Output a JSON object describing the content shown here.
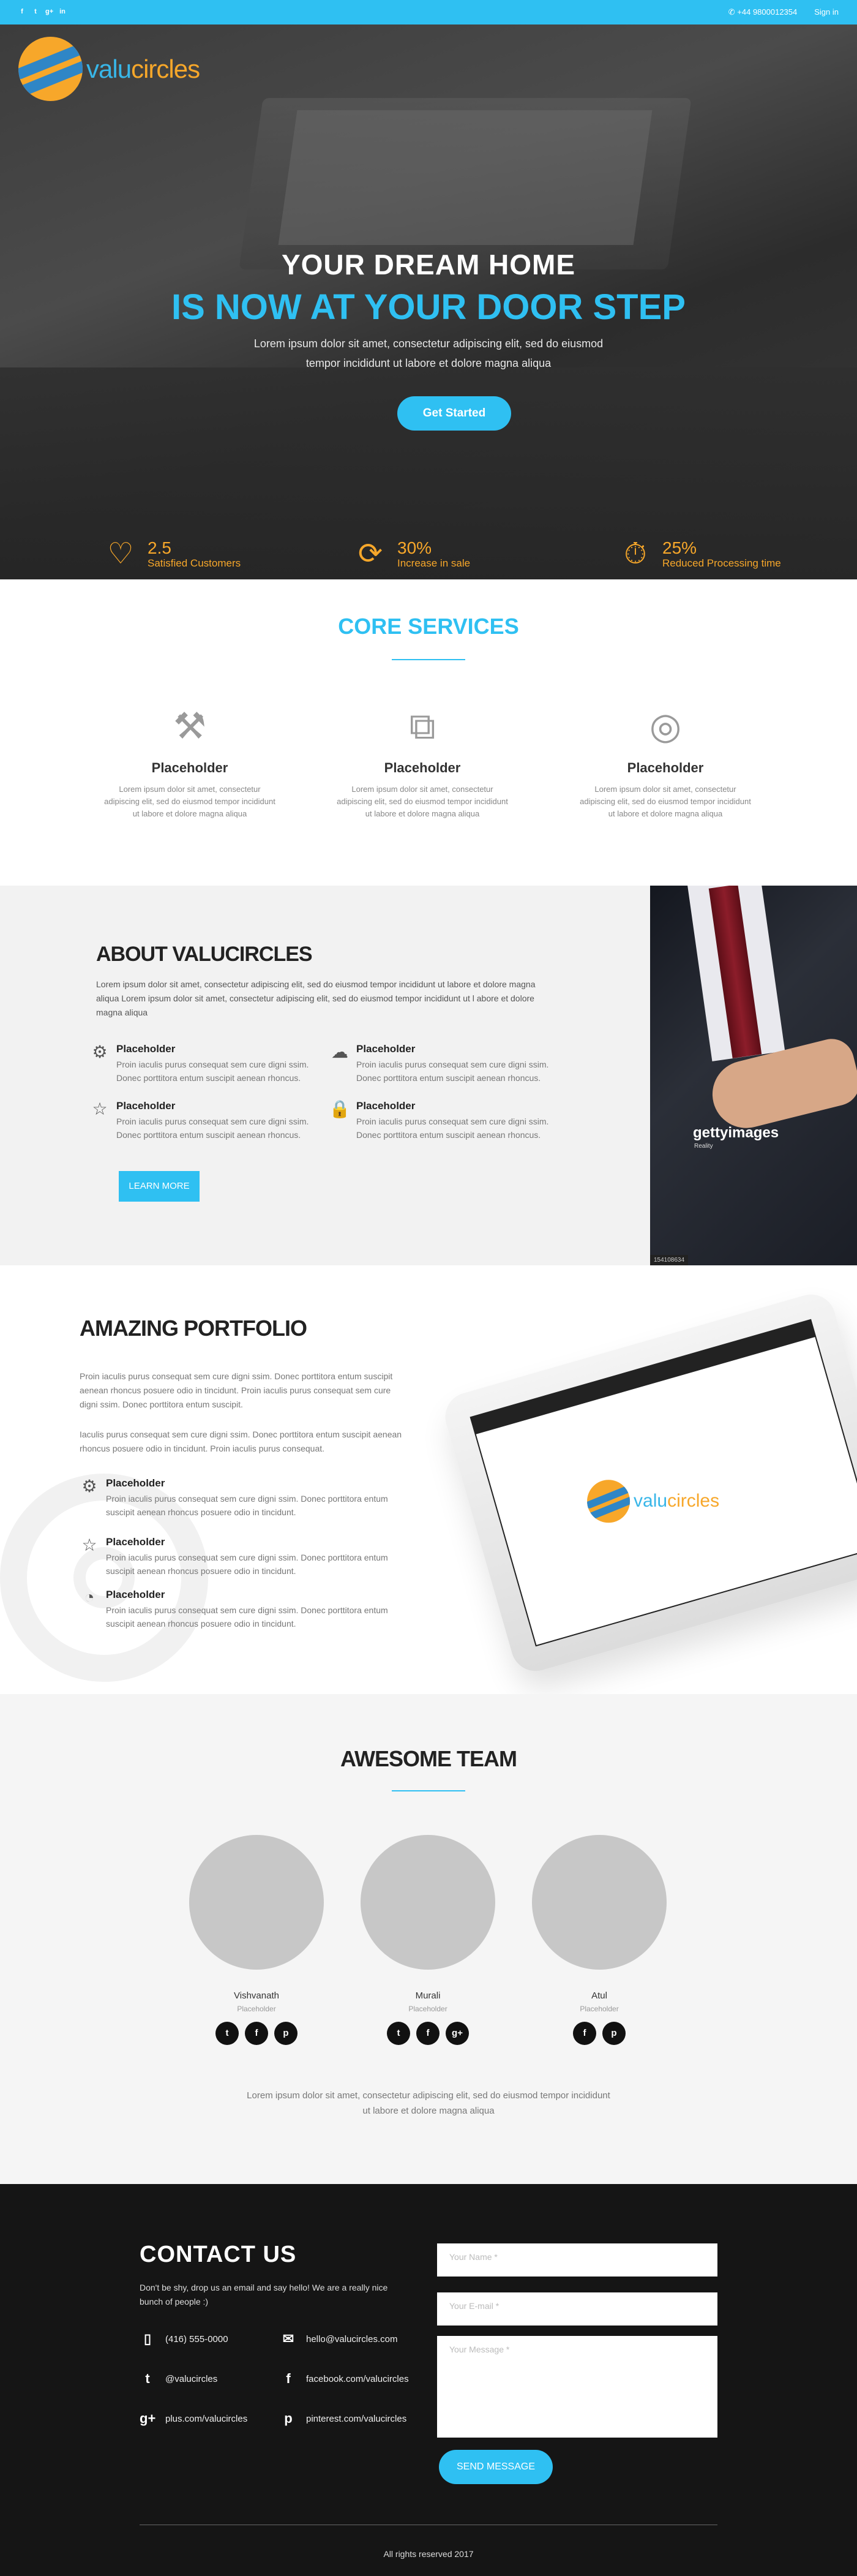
{
  "topbar": {
    "social_icons": [
      "facebook-icon",
      "twitter-icon",
      "google-plus-icon",
      "linkedin-icon"
    ],
    "social_glyphs": [
      "f",
      "t",
      "g+",
      "in"
    ],
    "phone": "+44 9800012354",
    "signin": "Sign in"
  },
  "logo": {
    "part1": "valu",
    "part2": "circles"
  },
  "hero": {
    "title_line1": "YOUR DREAM HOME",
    "title_line2": "IS NOW AT YOUR DOOR STEP",
    "lead": "Lorem ipsum dolor sit amet, consectetur adipiscing elit, sed do eiusmod tempor incididunt ut labore et dolore magna aliqua",
    "cta": "Get Started",
    "stats": [
      {
        "icon": "heart-icon",
        "value": "2.5",
        "label": "Satisfied Customers"
      },
      {
        "icon": "refresh-icon",
        "value": "30%",
        "label": "Increase in sale"
      },
      {
        "icon": "stopwatch-icon",
        "value": "25%",
        "label": "Reduced Processing time"
      }
    ]
  },
  "services": {
    "title": "CORE SERVICES",
    "items": [
      {
        "icon": "tools-icon",
        "title": "Placeholder",
        "text": "Lorem ipsum dolor sit amet, consectetur adipiscing elit, sed do eiusmod tempor incididunt ut labore et dolore magna aliqua"
      },
      {
        "icon": "hierarchy-icon",
        "title": "Placeholder",
        "text": "Lorem ipsum dolor sit amet, consectetur adipiscing elit, sed do eiusmod tempor incididunt ut labore et dolore magna aliqua"
      },
      {
        "icon": "lifebuoy-icon",
        "title": "Placeholder",
        "text": "Lorem ipsum dolor sit amet, consectetur adipiscing elit, sed do eiusmod tempor incididunt ut labore et dolore magna aliqua"
      }
    ]
  },
  "about": {
    "title": "ABOUT VALUCIRCLES",
    "intro": "Lorem ipsum dolor sit amet, consectetur adipiscing elit, sed do eiusmod tempor incididunt ut labore et dolore magna aliqua Lorem ipsum dolor sit amet, consectetur adipiscing elit, sed do eiusmod tempor incididunt ut l abore et dolore magna aliqua",
    "features": [
      {
        "icon": "gear-icon",
        "title": "Placeholder",
        "text": "Proin iaculis purus consequat sem cure digni ssim. Donec porttitora entum suscipit aenean rhoncus."
      },
      {
        "icon": "cloud-icon",
        "title": "Placeholder",
        "text": "Proin iaculis purus consequat sem cure digni ssim. Donec porttitora entum suscipit aenean rhoncus."
      },
      {
        "icon": "star-icon",
        "title": "Placeholder",
        "text": "Proin iaculis purus consequat sem cure digni ssim. Donec porttitora entum suscipit aenean rhoncus."
      },
      {
        "icon": "lock-icon",
        "title": "Placeholder",
        "text": "Proin iaculis purus consequat sem cure digni ssim. Donec porttitora entum suscipit aenean rhoncus."
      }
    ],
    "button": "LEARN MORE",
    "photo": {
      "brand": "gettyimages",
      "credit": "Reality",
      "code": "154108634"
    }
  },
  "portfolio": {
    "title": "AMAZING PORTFOLIO",
    "para1": "Proin iaculis purus consequat sem cure digni ssim. Donec porttitora entum suscipit aenean rhoncus posuere odio in tincidunt. Proin iaculis purus consequat sem cure digni ssim. Donec porttitora entum suscipit.",
    "para2": "Iaculis purus consequat sem cure digni ssim. Donec porttitora entum suscipit aenean rhoncus posuere odio in tincidunt. Proin iaculis purus consequat.",
    "features": [
      {
        "icon": "gear-icon",
        "title": "Placeholder",
        "text": "Proin iaculis purus consequat sem cure digni ssim. Donec porttitora entum suscipit aenean rhoncus posuere odio in tincidunt."
      },
      {
        "icon": "star-icon",
        "title": "Placeholder",
        "text": "Proin iaculis purus consequat sem cure digni ssim. Donec porttitora entum suscipit aenean rhoncus posuere odio in tincidunt."
      },
      {
        "icon": "pie-chart-icon",
        "title": "Placeholder",
        "text": "Proin iaculis purus consequat sem cure digni ssim. Donec porttitora entum suscipit aenean rhoncus posuere odio in tincidunt."
      }
    ]
  },
  "team": {
    "title": "AWESOME TEAM",
    "members": [
      {
        "name": "Vishvanath",
        "role": "Placeholder",
        "social": [
          {
            "icon": "twitter-icon",
            "glyph": "t"
          },
          {
            "icon": "facebook-icon",
            "glyph": "f"
          },
          {
            "icon": "pinterest-icon",
            "glyph": "p"
          }
        ]
      },
      {
        "name": "Murali",
        "role": "Placeholder",
        "social": [
          {
            "icon": "twitter-icon",
            "glyph": "t"
          },
          {
            "icon": "facebook-icon",
            "glyph": "f"
          },
          {
            "icon": "google-plus-icon",
            "glyph": "g+"
          }
        ]
      },
      {
        "name": "Atul",
        "role": "Placeholder",
        "social": [
          {
            "icon": "facebook-icon",
            "glyph": "f"
          },
          {
            "icon": "pinterest-icon",
            "glyph": "p"
          }
        ]
      }
    ],
    "footer_text": "Lorem ipsum dolor sit amet, consectetur adipiscing elit, sed do eiusmod tempor incididunt ut labore et dolore magna aliqua"
  },
  "contact": {
    "title": "CONTACT US",
    "subtitle": "Don't be shy, drop us an email and say hello! We are a really nice bunch of people :)",
    "items": [
      {
        "icon": "phone-icon",
        "glyph": "▯",
        "text": "(416) 555-0000"
      },
      {
        "icon": "email-icon",
        "glyph": "✉",
        "text": "hello@valucircles.com"
      },
      {
        "icon": "twitter-icon",
        "glyph": "t",
        "text": "@valucircles"
      },
      {
        "icon": "facebook-icon",
        "glyph": "f",
        "text": "facebook.com/valucircles"
      },
      {
        "icon": "google-plus-icon",
        "glyph": "g+",
        "text": "plus.com/valucircles"
      },
      {
        "icon": "pinterest-icon",
        "glyph": "p",
        "text": "pinterest.com/valucircles"
      }
    ],
    "name_placeholder": "Your Name *",
    "email_placeholder": "Your E-mail *",
    "message_placeholder": "Your Message *",
    "send": "SEND MESSAGE",
    "copyright": "All rights reserved 2017"
  },
  "colors": {
    "accent": "#2fc0f2",
    "brand_orange": "#f7a72a",
    "brand_blue": "#2f86c6",
    "footer_bg": "#151515"
  }
}
